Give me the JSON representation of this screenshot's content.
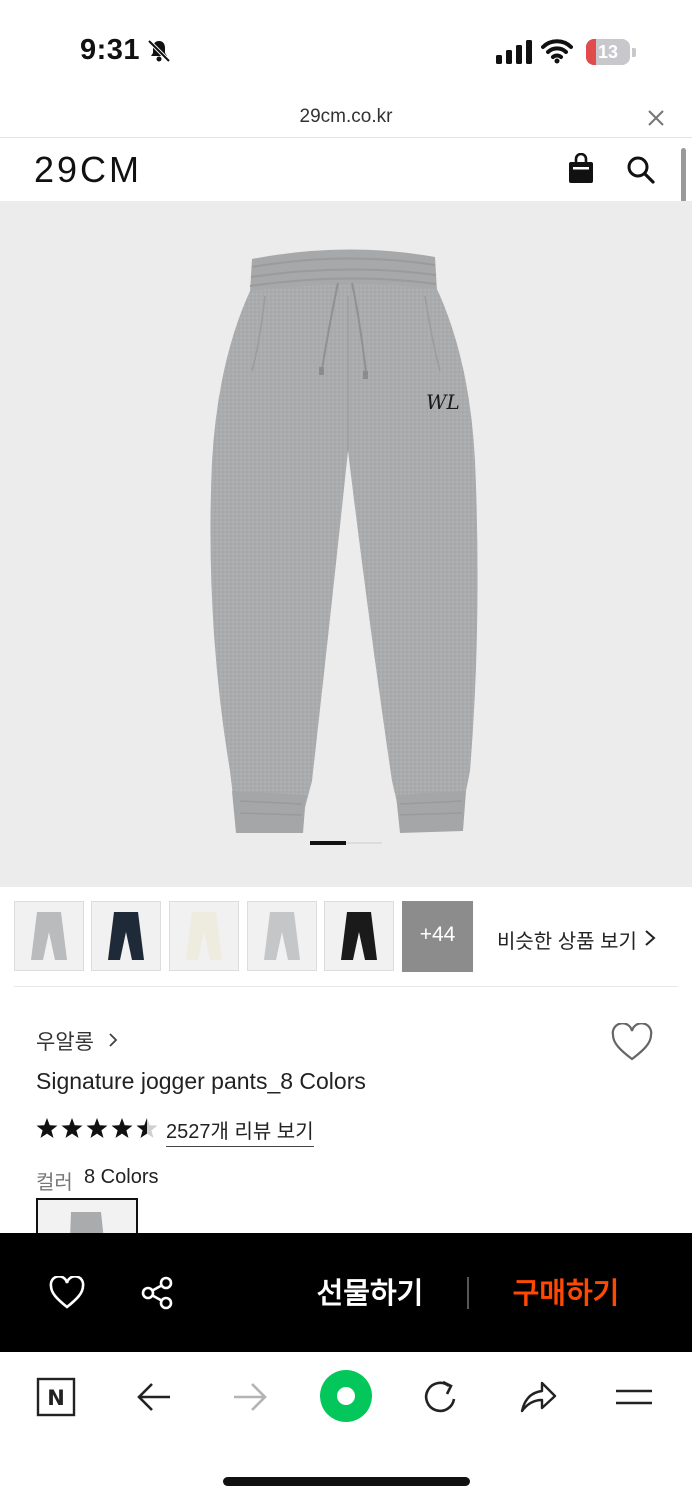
{
  "status_bar": {
    "time": "9:31",
    "battery_level": "13",
    "battery_color": "#e24b4b"
  },
  "browser": {
    "url": "29cm.co.kr"
  },
  "site": {
    "logo": "29CM"
  },
  "gallery": {
    "current_slide": 1,
    "image_background": "#ececec"
  },
  "thumbnails": {
    "colors": [
      "#b9bbbd",
      "#1f2a38",
      "#eeebdf",
      "#c4c6c8",
      "#1a1a1a"
    ],
    "more_label": "+44",
    "similar_label": "비슷한 상품 보기"
  },
  "product": {
    "brand": "우알롱",
    "title": "Signature jogger pants_8 Colors",
    "rating": 4.5,
    "review_link": "2527개 리뷰 보기",
    "color_label": "컬러",
    "color_count": "8 Colors"
  },
  "purchase_bar": {
    "gift_label": "선물하기",
    "buy_label": "구매하기",
    "buy_color": "#ff4800"
  },
  "toolbar": {
    "icons": [
      "naver-n-icon",
      "back-arrow-icon",
      "forward-arrow-icon",
      "green-home-icon",
      "reload-icon",
      "share-arrow-icon",
      "menu-icon"
    ],
    "accent": "#03c75a"
  }
}
